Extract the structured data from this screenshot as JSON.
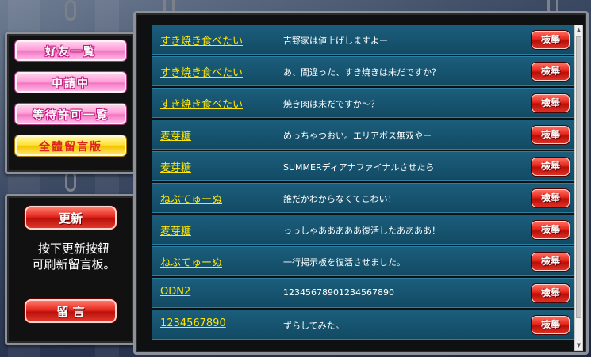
{
  "sidebar": {
    "menu": [
      {
        "label": "好友一覧"
      },
      {
        "label": "申請中"
      },
      {
        "label": "等待許可一覧"
      },
      {
        "label": "全體留言版"
      }
    ],
    "refresh_label": "更新",
    "info_line1": "按下更新按鈕",
    "info_line2": "可刷新留言板。",
    "post_label": "留 言"
  },
  "board": {
    "report_label": "檢舉",
    "messages": [
      {
        "name": "すき焼き食べたい",
        "text": "吉野家は値上げしますよー"
      },
      {
        "name": "すき焼き食べたい",
        "text": "あ、間違った、すき焼きは未だですか？"
      },
      {
        "name": "すき焼き食べたい",
        "text": "焼き肉は未だですか～？"
      },
      {
        "name": "麦芽糖",
        "text": "めっちゃつおい。エリアボス無双やー"
      },
      {
        "name": "麦芽糖",
        "text": "SUMMERディアナファイナルさせたら"
      },
      {
        "name": "ねぶてゅーぬ",
        "text": "誰だかわからなくてこわい！"
      },
      {
        "name": "麦芽糖",
        "text": "っっしゃあああああ復活したああああ！"
      },
      {
        "name": "ねぶてゅーぬ",
        "text": "一行掲示板を復活させました。"
      },
      {
        "name": "ODN2",
        "text": "12345678901234567890"
      },
      {
        "name": "1234567890",
        "text": "ずらしてみた。"
      }
    ]
  }
}
